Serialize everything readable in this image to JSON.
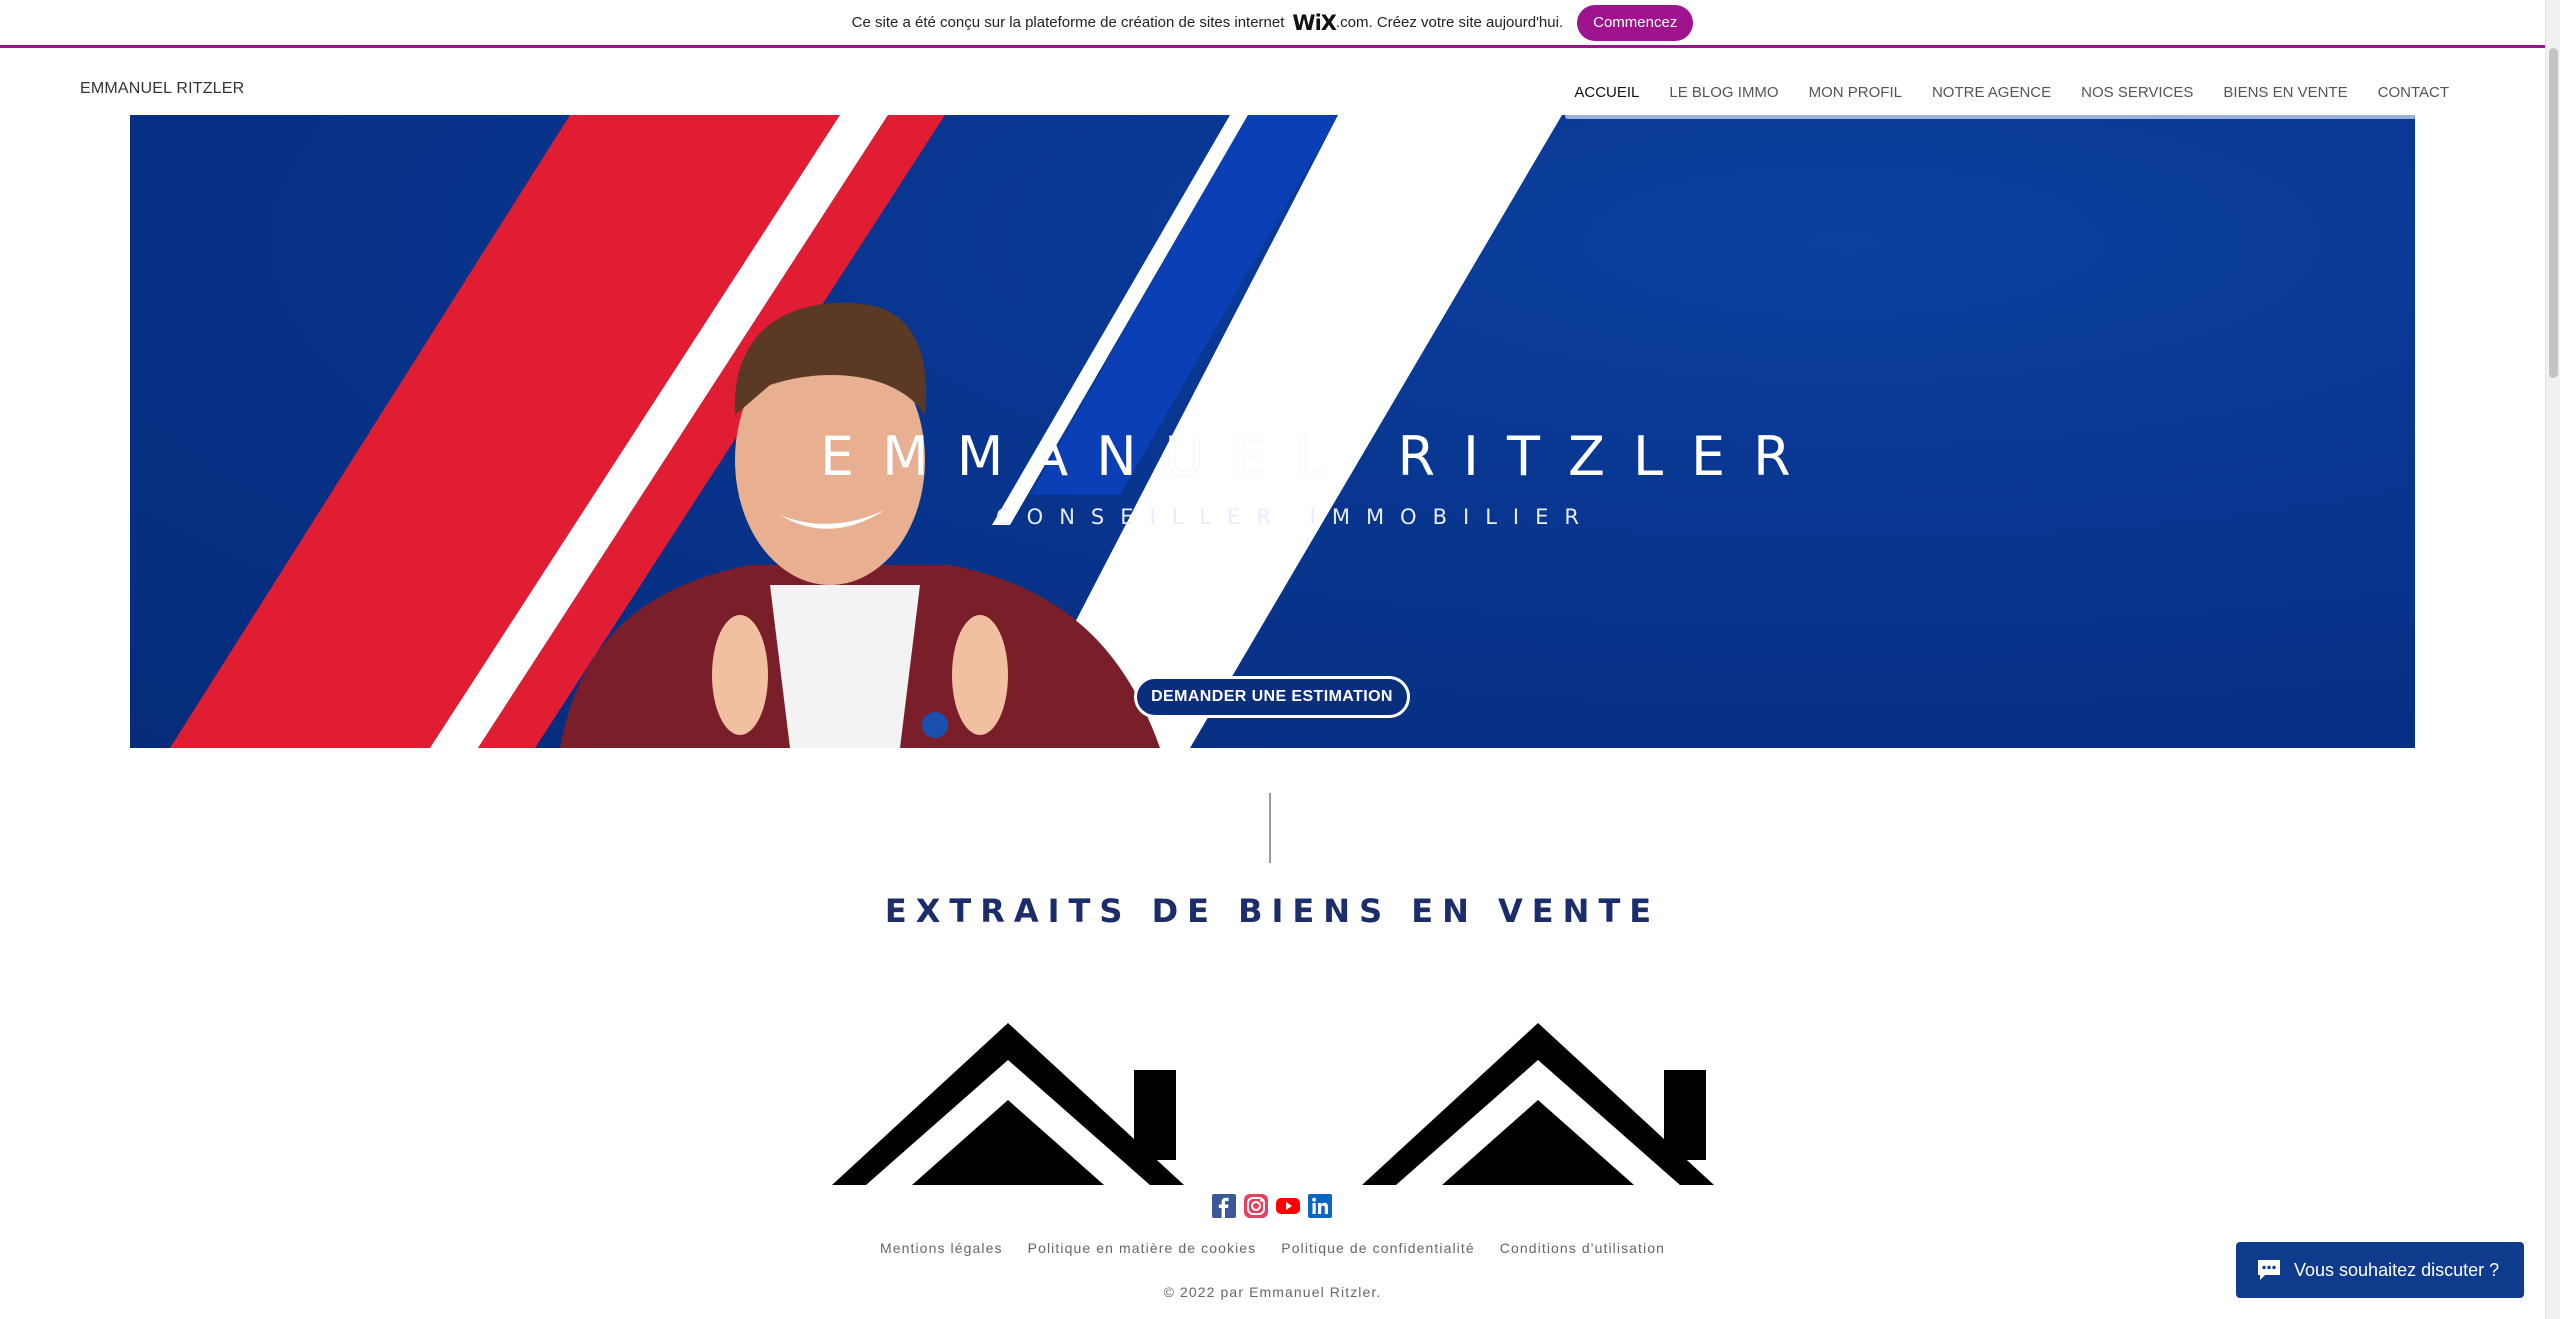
{
  "wix_banner": {
    "text_before": "Ce site a été conçu sur la plateforme de création de sites internet",
    "logo": "WiX",
    "text_after": ".com. Créez votre site aujourd'hui.",
    "cta": "Commencez",
    "accent_color": "#a0138e"
  },
  "header": {
    "site_name": "EMMANUEL RITZLER",
    "nav": [
      "ACCUEIL",
      "LE BLOG IMMO",
      "MON PROFIL",
      "NOTRE AGENCE",
      "NOS SERVICES",
      "BIENS EN VENTE",
      "CONTACT"
    ],
    "active_index": 0
  },
  "hero": {
    "title": "EMMANUEL RITZLER",
    "subtitle": "CONSEILLER IMMOBILIER",
    "button": "DEMANDER UNE ESTIMATION",
    "background_color": "#08358e",
    "stripe_red": "#e11d33",
    "stripe_blue": "#0b3fb5"
  },
  "section": {
    "title": "EXTRAITS DE BIENS EN VENTE",
    "title_color": "#1b2e6b"
  },
  "social": [
    "facebook-icon",
    "instagram-icon",
    "youtube-icon",
    "linkedin-icon"
  ],
  "footer": {
    "links": [
      "Mentions légales",
      "Politique en matière de cookies",
      "Politique de confidentialité",
      "Conditions d'utilisation"
    ],
    "copyright": "© 2022 par Emmanuel Ritzler."
  },
  "chat": {
    "label": "Vous souhaitez discuter ?",
    "icon": "chat-bubble-icon"
  }
}
